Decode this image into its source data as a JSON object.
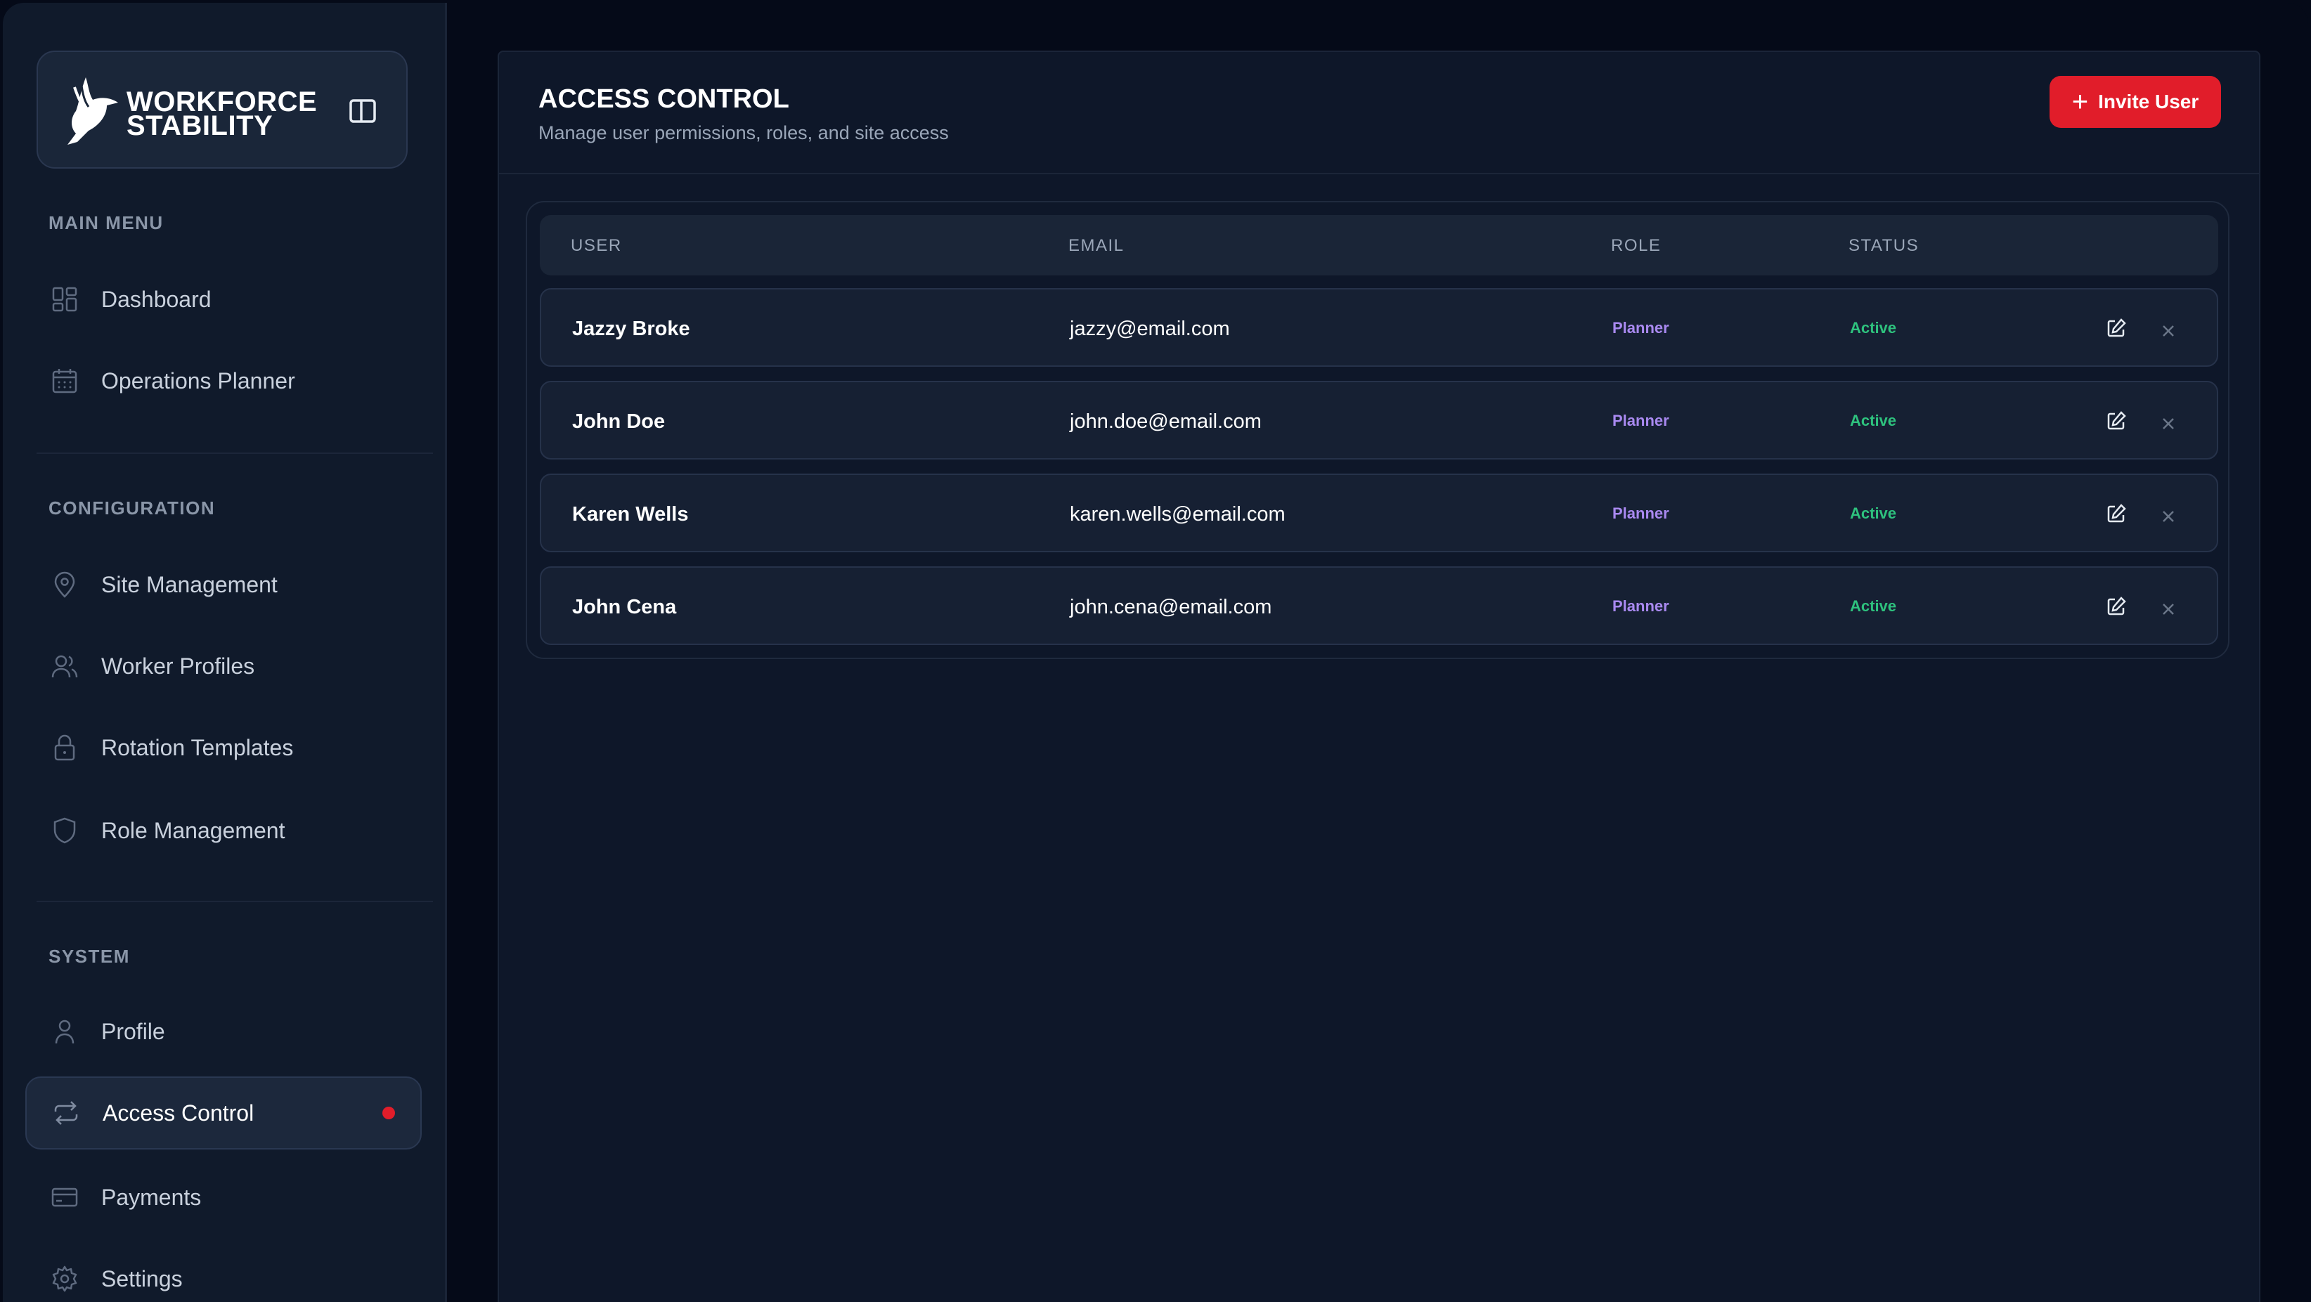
{
  "brand": {
    "name": "WORKFORCE\nSTABILITY"
  },
  "sidebar": {
    "sections": [
      {
        "label": "MAIN MENU"
      },
      {
        "label": "CONFIGURATION"
      },
      {
        "label": "SYSTEM"
      }
    ],
    "items": [
      {
        "label": "Dashboard",
        "icon": "dashboard-icon"
      },
      {
        "label": "Operations Planner",
        "icon": "calendar-icon"
      },
      {
        "label": "Site Management",
        "icon": "map-pin-icon"
      },
      {
        "label": "Worker Profiles",
        "icon": "users-icon"
      },
      {
        "label": "Rotation Templates",
        "icon": "lock-icon"
      },
      {
        "label": "Role Management",
        "icon": "shield-icon"
      },
      {
        "label": "Profile",
        "icon": "user-icon"
      },
      {
        "label": "Access Control",
        "icon": "repeat-icon",
        "active": true
      },
      {
        "label": "Payments",
        "icon": "credit-card-icon"
      },
      {
        "label": "Settings",
        "icon": "gear-icon"
      }
    ]
  },
  "header": {
    "title": "ACCESS CONTROL",
    "subtitle": "Manage user permissions, roles, and site access",
    "invite_label": "Invite User"
  },
  "table": {
    "columns": [
      "USER",
      "EMAIL",
      "ROLE",
      "STATUS"
    ],
    "rows": [
      {
        "user": "Jazzy Broke",
        "email": "jazzy@email.com",
        "role": "Planner",
        "status": "Active"
      },
      {
        "user": "John Doe",
        "email": "john.doe@email.com",
        "role": "Planner",
        "status": "Active"
      },
      {
        "user": "Karen Wells",
        "email": "karen.wells@email.com",
        "role": "Planner",
        "status": "Active"
      },
      {
        "user": "John Cena",
        "email": "john.cena@email.com",
        "role": "Planner",
        "status": "Active"
      }
    ]
  },
  "colors": {
    "accent": "#e11d2a",
    "role": "#a989f0",
    "status_active": "#2ec27e",
    "background": "#050a18",
    "panel": "#0e1729"
  }
}
